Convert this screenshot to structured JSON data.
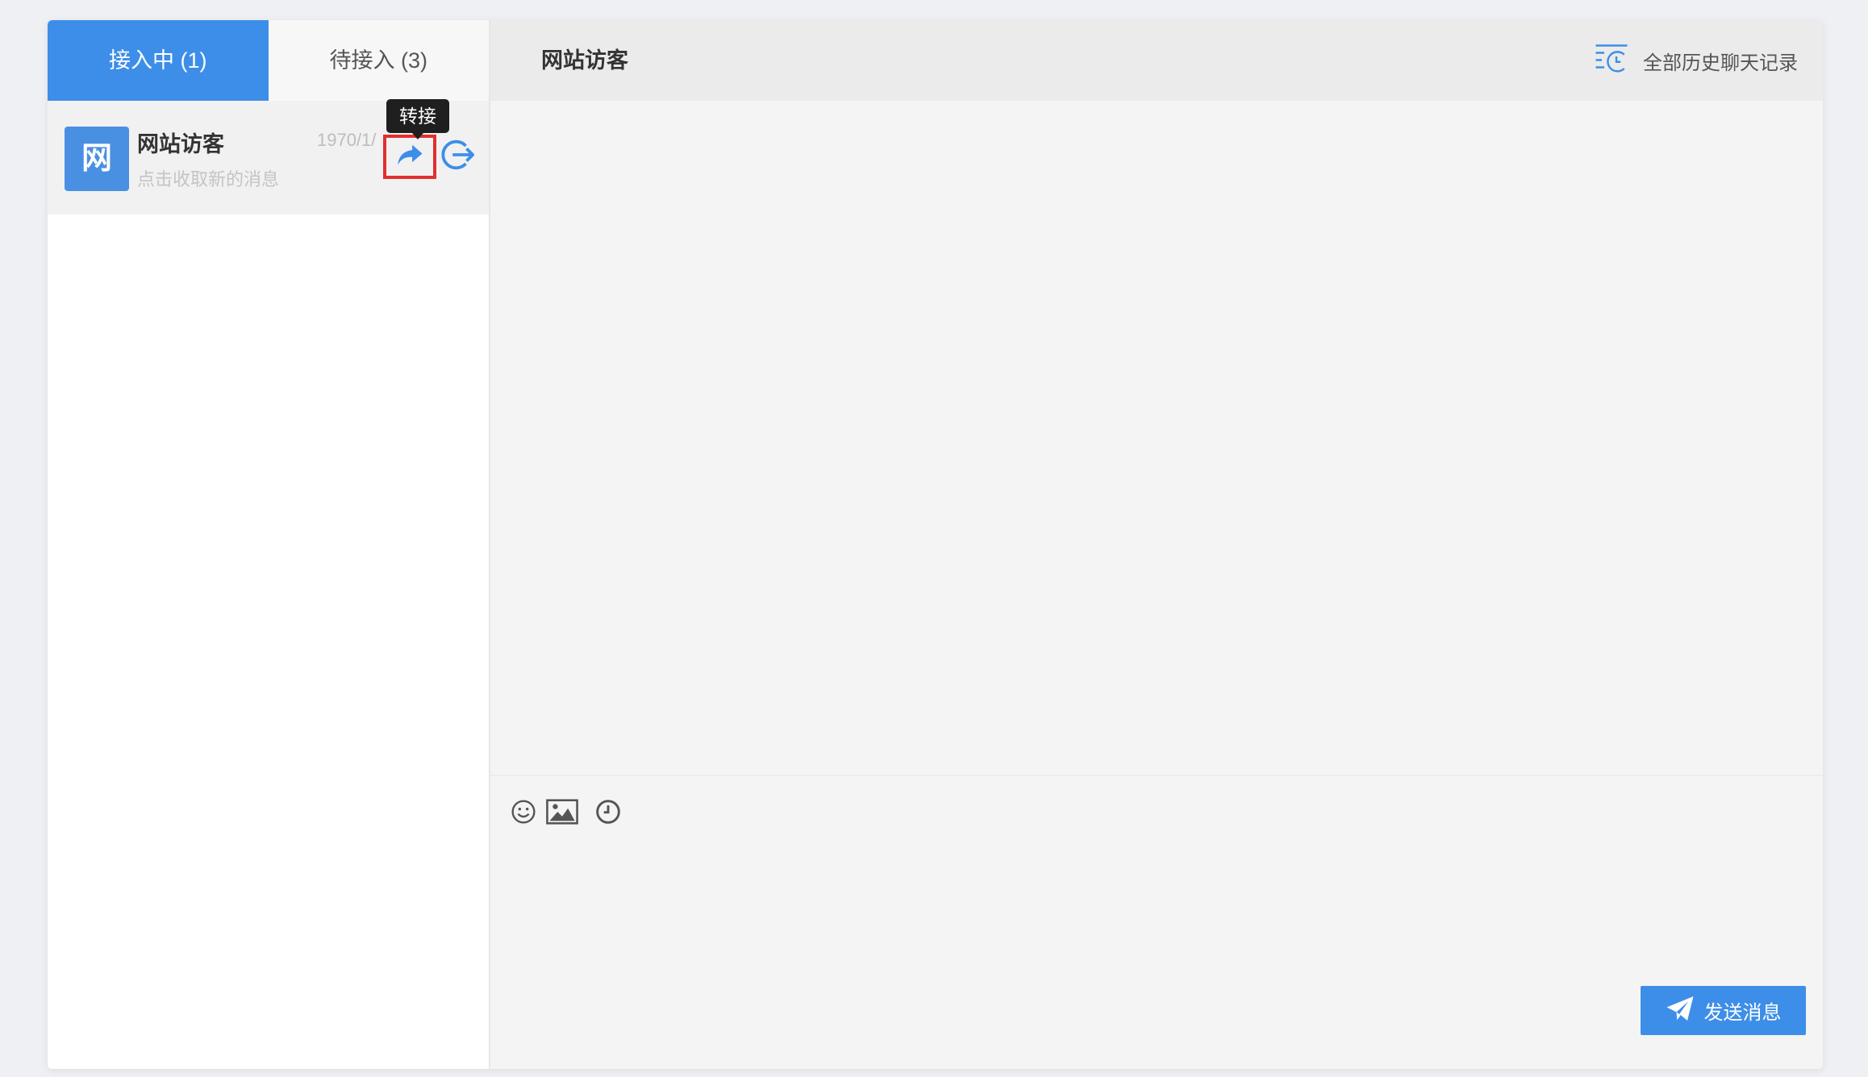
{
  "tabs": [
    {
      "label": "接入中 (1)",
      "active": true
    },
    {
      "label": "待接入 (3)",
      "active": false
    }
  ],
  "sessions": [
    {
      "avatar_text": "网",
      "name": "网站访客",
      "time": "1970/1/",
      "preview": "点击收取新的消息",
      "actions": [
        "transfer-icon",
        "exit-icon"
      ]
    }
  ],
  "tooltip": {
    "text": "转接"
  },
  "chat": {
    "title": "网站访客",
    "history_label": "全部历史聊天记录",
    "history_icon": "history-list-icon"
  },
  "toolbar": {
    "icons": [
      "emoji-icon",
      "image-icon",
      "clock-icon"
    ]
  },
  "input": {
    "value": ""
  },
  "send_button": {
    "label": "发送消息",
    "icon": "paper-plane-icon"
  },
  "colors": {
    "primary": "#3d8ee8",
    "highlight_box": "#e0302f",
    "tooltip_bg": "#1f1f1f"
  }
}
